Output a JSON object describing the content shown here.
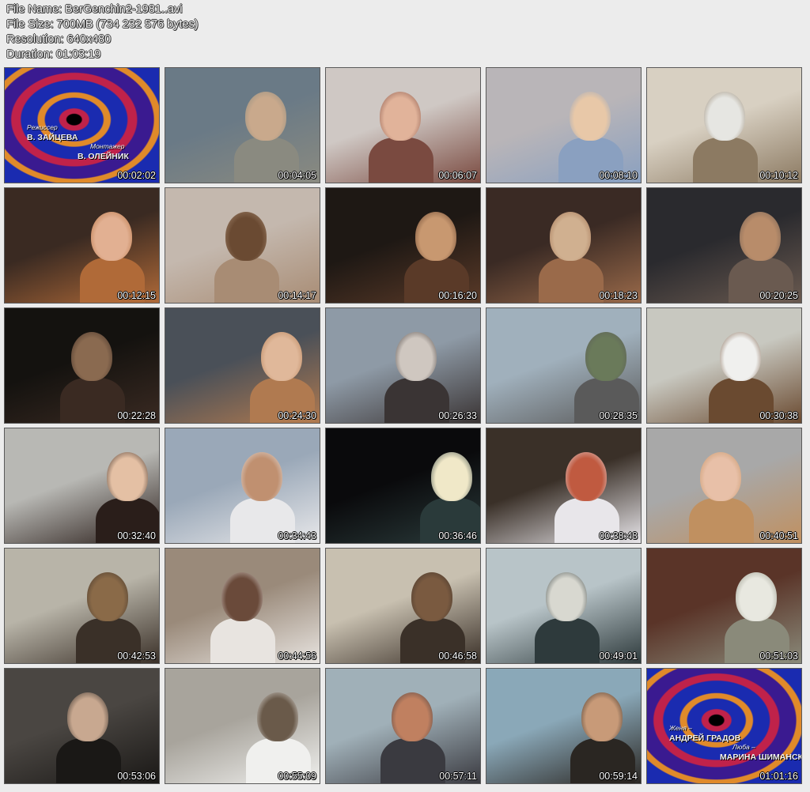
{
  "file_info": {
    "file_name": "File Name: BerGenchin2-1981..avi",
    "file_size": "File Size: 700MB (734 232 576 bytes)",
    "resolution": "Resolution: 640x480",
    "duration": "Duration: 01:03:19"
  },
  "thumbnails": [
    {
      "timestamp": "00:02:02",
      "colors": [
        "#1a2bb0",
        "#c0224a",
        "#e08a2a"
      ],
      "credits": [
        "Режиссер",
        "В. ЗАЙЦЕВА",
        "Монтажер",
        "В. ОЛЕЙНИК"
      ]
    },
    {
      "timestamp": "00:04:05",
      "colors": [
        "#6a7a86",
        "#8a8a80",
        "#c9a98c"
      ]
    },
    {
      "timestamp": "00:06:07",
      "colors": [
        "#cfc8c4",
        "#7a4a40",
        "#e1b39a"
      ]
    },
    {
      "timestamp": "00:08:10",
      "colors": [
        "#b9b5b8",
        "#8aa0c0",
        "#e8c8a8"
      ]
    },
    {
      "timestamp": "00:10:12",
      "colors": [
        "#d8d0c2",
        "#8c7a62",
        "#e6e6e2"
      ]
    },
    {
      "timestamp": "00:12:15",
      "colors": [
        "#3a2a22",
        "#b06a38",
        "#e2b092"
      ]
    },
    {
      "timestamp": "00:14:17",
      "colors": [
        "#c4b8ae",
        "#a88c74",
        "#6a4a32"
      ]
    },
    {
      "timestamp": "00:16:20",
      "colors": [
        "#1e1814",
        "#5a3a28",
        "#c89870"
      ]
    },
    {
      "timestamp": "00:18:23",
      "colors": [
        "#3a2a24",
        "#9a6a4a",
        "#d0b090"
      ]
    },
    {
      "timestamp": "00:20:25",
      "colors": [
        "#2a2a2e",
        "#6a5a50",
        "#b88c6a"
      ]
    },
    {
      "timestamp": "00:22:28",
      "colors": [
        "#14120f",
        "#3a2a22",
        "#8a6a50"
      ]
    },
    {
      "timestamp": "00:24:30",
      "colors": [
        "#4a5058",
        "#b07a50",
        "#e0b89a"
      ]
    },
    {
      "timestamp": "00:26:33",
      "colors": [
        "#8e9aa6",
        "#3a3434",
        "#cfc7c0"
      ]
    },
    {
      "timestamp": "00:28:35",
      "colors": [
        "#a0b0bc",
        "#5a5a5a",
        "#6a7a5a"
      ]
    },
    {
      "timestamp": "00:30:38",
      "colors": [
        "#c8c8c0",
        "#6a4a30",
        "#f0f0ee"
      ]
    },
    {
      "timestamp": "00:32:40",
      "colors": [
        "#b8b8b4",
        "#2a1e1a",
        "#e4c0a4"
      ]
    },
    {
      "timestamp": "00:34:43",
      "colors": [
        "#9aa8b8",
        "#e8e8ea",
        "#c09070"
      ]
    },
    {
      "timestamp": "00:36:46",
      "colors": [
        "#0a0a0c",
        "#2a3a3a",
        "#f0e8c8"
      ]
    },
    {
      "timestamp": "00:38:48",
      "colors": [
        "#3a3028",
        "#e8e6ea",
        "#c05a40"
      ]
    },
    {
      "timestamp": "00:40:51",
      "colors": [
        "#a8a8a8",
        "#c09060",
        "#e8c0a8"
      ]
    },
    {
      "timestamp": "00:42:53",
      "colors": [
        "#b8b4a8",
        "#3a3028",
        "#8a6a48"
      ]
    },
    {
      "timestamp": "00:44:56",
      "colors": [
        "#9a8a7a",
        "#e8e4e0",
        "#6a4a3a"
      ]
    },
    {
      "timestamp": "00:46:58",
      "colors": [
        "#c8c0b0",
        "#3a3028",
        "#7a5a40"
      ]
    },
    {
      "timestamp": "00:49:01",
      "colors": [
        "#b8c4c8",
        "#2e3a3c",
        "#d8d8d0"
      ]
    },
    {
      "timestamp": "00:51:03",
      "colors": [
        "#5a3428",
        "#8a8a7a",
        "#e8e8e0"
      ]
    },
    {
      "timestamp": "00:53:06",
      "colors": [
        "#4a4642",
        "#1a1816",
        "#c8a890"
      ]
    },
    {
      "timestamp": "00:55:09",
      "colors": [
        "#a8a49c",
        "#f0f0ee",
        "#6a5a4a"
      ]
    },
    {
      "timestamp": "00:57:11",
      "colors": [
        "#a0b0b8",
        "#3a3a40",
        "#c08060"
      ]
    },
    {
      "timestamp": "00:59:14",
      "colors": [
        "#8aa8b8",
        "#2a2622",
        "#c89a78"
      ]
    },
    {
      "timestamp": "01:01:16",
      "colors": [
        "#1a2bb0",
        "#c0224a",
        "#e08a2a"
      ],
      "credits": [
        "Женя –",
        "АНДРЕЙ ГРАДОВ",
        "Люба –",
        "МАРИНА ШИМАНСКАЯ"
      ]
    }
  ]
}
